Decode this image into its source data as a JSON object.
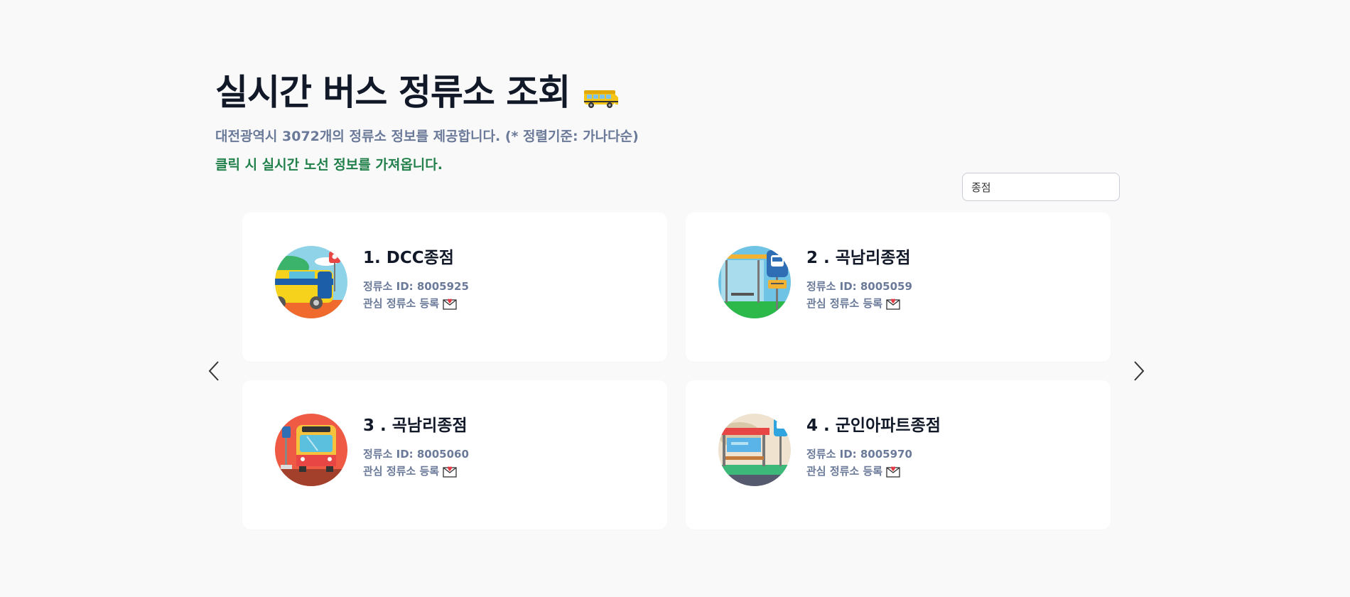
{
  "header": {
    "title": "실시간 버스 정류소 조회",
    "subtitle": "대전광역시 3072개의 정류소 정보를 제공합니다. (* 정렬기준: 가나다순)",
    "hint": "클릭 시 실시간 노선 정보를 가져옵니다."
  },
  "search": {
    "value": "종점"
  },
  "carousel": {
    "prev_icon": "chevron-left-icon",
    "next_icon": "chevron-right-icon"
  },
  "stops": [
    {
      "title": "1. DCC종점",
      "id_text": "정류소 ID: 8005925",
      "fav_label": "관심 정류소 등록",
      "image": "yellow-bus-illustration"
    },
    {
      "title": "2 . 곡남리종점",
      "id_text": "정류소 ID: 8005059",
      "fav_label": "관심 정류소 등록",
      "image": "bus-shelter-illustration"
    },
    {
      "title": "3 . 곡남리종점",
      "id_text": "정류소 ID: 8005060",
      "fav_label": "관심 정류소 등록",
      "image": "red-bus-front-illustration"
    },
    {
      "title": "4 . 군인아파트종점",
      "id_text": "정류소 ID: 8005970",
      "fav_label": "관심 정류소 등록",
      "image": "bus-stop-bench-illustration"
    }
  ]
}
